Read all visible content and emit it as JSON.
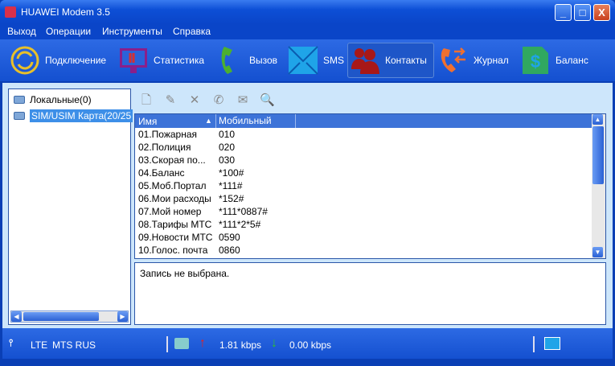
{
  "window": {
    "title": "HUAWEI Modem 3.5",
    "minimize": "_",
    "maximize": "□",
    "close": "X"
  },
  "menu": [
    "Выход",
    "Операции",
    "Инструменты",
    "Справка"
  ],
  "toolbar": [
    {
      "label": "Подключение",
      "icon": "connect-icon"
    },
    {
      "label": "Статистика",
      "icon": "statistics-icon"
    },
    {
      "label": "Вызов",
      "icon": "phone-icon"
    },
    {
      "label": "SMS",
      "icon": "sms-icon"
    },
    {
      "label": "Контакты",
      "icon": "contacts-icon"
    },
    {
      "label": "Журнал",
      "icon": "log-icon"
    },
    {
      "label": "Баланс",
      "icon": "balance-icon"
    }
  ],
  "tree": [
    {
      "label": "Локальные(0)"
    },
    {
      "label": "SIM/USIM Карта(20/25"
    }
  ],
  "table": {
    "columns": [
      "Имя",
      "Мобильный"
    ],
    "sort_indicator": "▲",
    "rows": [
      [
        "01.Пожарная",
        "010"
      ],
      [
        "02.Полиция",
        "020"
      ],
      [
        "03.Скорая по...",
        "030"
      ],
      [
        "04.Баланс",
        "*100#"
      ],
      [
        "05.Моб.Портал",
        "*111#"
      ],
      [
        "06.Мои расходы",
        "*152#"
      ],
      [
        "07.Мой номер",
        "*111*0887#"
      ],
      [
        "08.Тарифы МТС",
        "*111*2*5#"
      ],
      [
        "09.Новости МТС",
        "0590"
      ],
      [
        "10.Голос. почта",
        "0860"
      ]
    ]
  },
  "detail": "Запись не выбрана.",
  "status": {
    "network": "LTE",
    "operator": "MTS RUS",
    "upload": "1.81 kbps",
    "download": "0.00 kbps"
  },
  "colors": {
    "accent": "#0a45c8",
    "selection": "#3d8fe8",
    "panel": "#cde6fb"
  }
}
